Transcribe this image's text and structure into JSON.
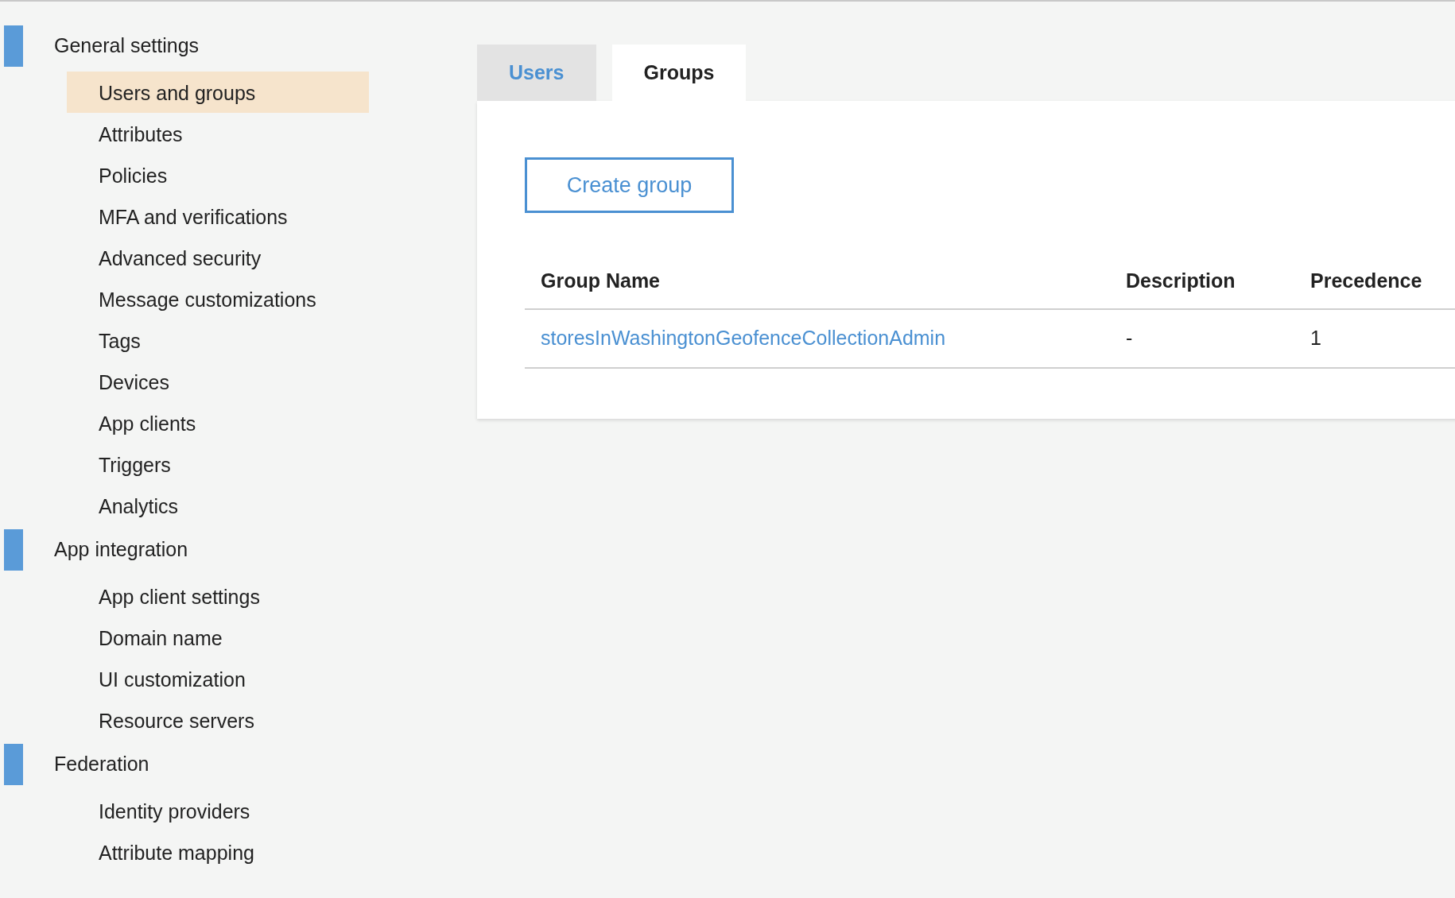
{
  "sidebar": {
    "sections": [
      {
        "title": "General settings",
        "items": [
          {
            "label": "Users and groups",
            "selected": true
          },
          {
            "label": "Attributes",
            "selected": false
          },
          {
            "label": "Policies",
            "selected": false
          },
          {
            "label": "MFA and verifications",
            "selected": false
          },
          {
            "label": "Advanced security",
            "selected": false
          },
          {
            "label": "Message customizations",
            "selected": false
          },
          {
            "label": "Tags",
            "selected": false
          },
          {
            "label": "Devices",
            "selected": false
          },
          {
            "label": "App clients",
            "selected": false
          },
          {
            "label": "Triggers",
            "selected": false
          },
          {
            "label": "Analytics",
            "selected": false
          }
        ]
      },
      {
        "title": "App integration",
        "items": [
          {
            "label": "App client settings",
            "selected": false
          },
          {
            "label": "Domain name",
            "selected": false
          },
          {
            "label": "UI customization",
            "selected": false
          },
          {
            "label": "Resource servers",
            "selected": false
          }
        ]
      },
      {
        "title": "Federation",
        "items": [
          {
            "label": "Identity providers",
            "selected": false
          },
          {
            "label": "Attribute mapping",
            "selected": false
          }
        ]
      }
    ]
  },
  "tabs": [
    {
      "label": "Users",
      "selected": false
    },
    {
      "label": "Groups",
      "selected": true
    }
  ],
  "create_button": "Create group",
  "table": {
    "columns": [
      "Group Name",
      "Description",
      "Precedence"
    ],
    "rows": [
      [
        "storesInWashingtonGeofenceCollectionAdmin",
        "-",
        "1"
      ]
    ]
  }
}
